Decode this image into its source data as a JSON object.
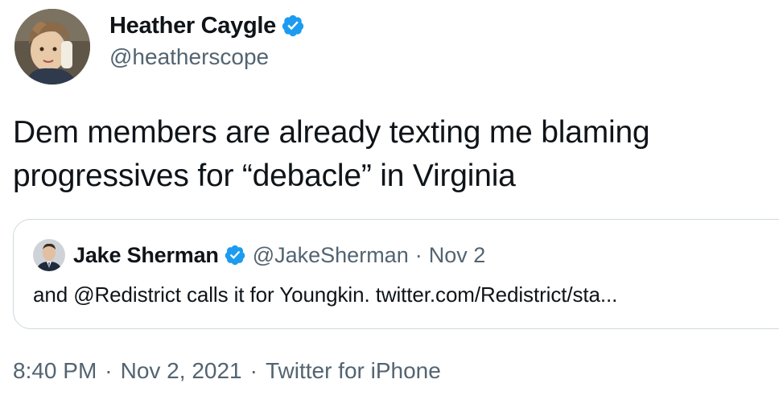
{
  "author": {
    "display_name": "Heather Caygle",
    "handle": "@heatherscope",
    "verified_icon": "verified-badge-icon"
  },
  "tweet": {
    "text": "Dem members are already texting me blaming progressives for “debacle” in Virginia"
  },
  "quoted_tweet": {
    "display_name": "Jake Sherman",
    "handle": "@JakeSherman",
    "separator": "·",
    "date": "Nov 2",
    "text": "and @Redistrict calls it for Youngkin. twitter.com/Redistrict/sta..."
  },
  "meta": {
    "time": "8:40 PM",
    "separator": "·",
    "date": "Nov 2, 2021",
    "source": "Twitter for iPhone"
  },
  "colors": {
    "text_primary": "#0f1419",
    "text_secondary": "#536471",
    "verified_blue": "#1d9bf0",
    "card_border": "#cfd9de"
  }
}
